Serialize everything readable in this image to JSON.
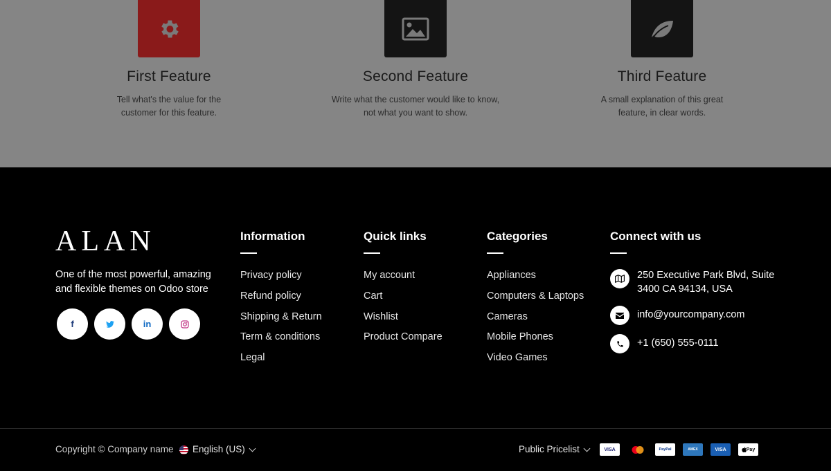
{
  "features": [
    {
      "title": "First Feature",
      "text": "Tell what's the value for the customer for this feature.",
      "icon": "gear-icon",
      "tile_color": "#8a1a1a"
    },
    {
      "title": "Second Feature",
      "text": "Write what the customer would like to know, not what you want to show.",
      "icon": "image-icon",
      "tile_color": "#141414"
    },
    {
      "title": "Third Feature",
      "text": "A small explanation of this great feature, in clear words.",
      "icon": "leaf-icon",
      "tile_color": "#141414"
    }
  ],
  "footer": {
    "brand": "ALAN",
    "tagline": "One of the most powerful, amazing and flexible themes on Odoo store",
    "socials": [
      {
        "icon": "facebook-icon",
        "glyph": "f"
      },
      {
        "icon": "twitter-icon",
        "glyph": "t"
      },
      {
        "icon": "linkedin-icon",
        "glyph": "in"
      },
      {
        "icon": "instagram-icon",
        "glyph": "ig"
      }
    ],
    "columns": [
      {
        "title": "Information",
        "links": [
          "Privacy policy",
          "Refund policy",
          "Shipping & Return",
          "Term & conditions",
          "Legal"
        ]
      },
      {
        "title": "Quick links",
        "links": [
          "My account",
          "Cart",
          "Wishlist",
          "Product Compare"
        ]
      },
      {
        "title": "Categories",
        "links": [
          "Appliances",
          "Computers & Laptops",
          "Cameras",
          "Mobile Phones",
          "Video Games"
        ]
      }
    ],
    "contact": {
      "title": "Connect with us",
      "address": "250 Executive Park Blvd, Suite 3400 CA 94134, USA",
      "email": "info@yourcompany.com",
      "phone": "+1 (650) 555-0111"
    }
  },
  "bottom": {
    "copyright": "Copyright © Company name",
    "language": "English (US)",
    "pricelist": "Public Pricelist",
    "payments": [
      {
        "name": "visa-icon",
        "label": "VISA"
      },
      {
        "name": "mastercard-icon",
        "label": ""
      },
      {
        "name": "paypal-icon",
        "label": "PayPal"
      },
      {
        "name": "amex-icon",
        "label": "AMEX"
      },
      {
        "name": "visa-electron-icon",
        "label": "VISA"
      },
      {
        "name": "apple-pay-icon",
        "label": "Pay"
      }
    ]
  }
}
